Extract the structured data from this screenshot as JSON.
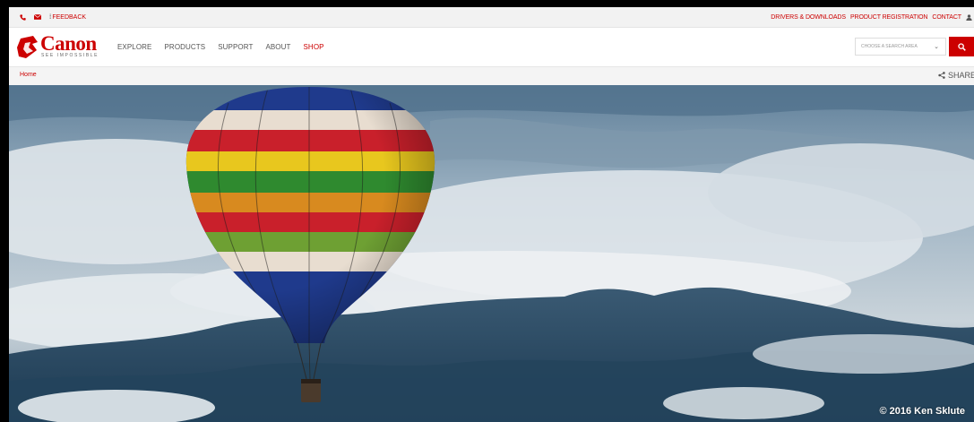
{
  "utility": {
    "feedback": "FEEDBACK",
    "links": [
      "DRIVERS & DOWNLOADS",
      "PRODUCT REGISTRATION",
      "CONTACT"
    ]
  },
  "brand": {
    "name": "Canon",
    "tagline": "SEE IMPOSSIBLE",
    "color": "#cc0000"
  },
  "nav": {
    "items": [
      "EXPLORE",
      "PRODUCTS",
      "SUPPORT",
      "ABOUT",
      "SHOP"
    ]
  },
  "search": {
    "select_label": "CHOOSE A SEARCH AREA",
    "button_icon": "search-icon"
  },
  "breadcrumb": {
    "home": "Home",
    "share": "SHARE"
  },
  "hero": {
    "credit": "© 2016 Ken Sklute",
    "subject": "hot-air-balloon"
  }
}
